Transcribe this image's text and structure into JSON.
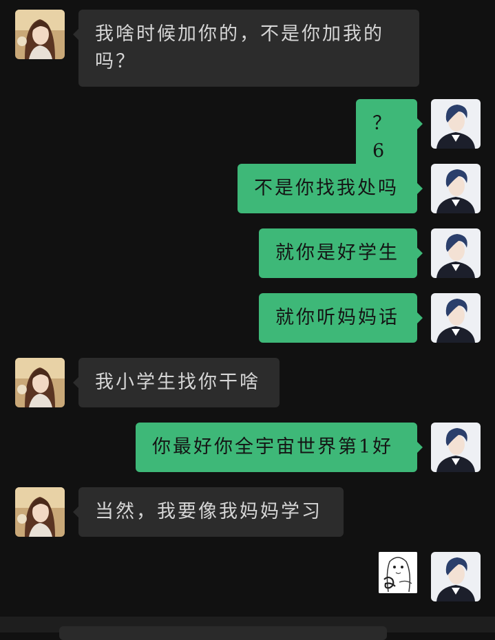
{
  "conversation": {
    "messages": [
      {
        "side": "in",
        "text": "我啥时候加你的，不是你加我的吗？"
      },
      {
        "side": "out",
        "text": "？6"
      },
      {
        "side": "out",
        "text": "不是你找我处吗"
      },
      {
        "side": "out",
        "text": "就你是好学生"
      },
      {
        "side": "out",
        "text": "就你听妈妈话"
      },
      {
        "side": "in",
        "text": "我小学生找你干啥"
      },
      {
        "side": "out",
        "text": "你最好你全宇宙世界第1好"
      },
      {
        "side": "in",
        "text": "当然，我要像我妈妈学习"
      },
      {
        "side": "out",
        "type": "sticker",
        "icon": "meme-sticker"
      }
    ]
  },
  "colors": {
    "background": "#111111",
    "incoming_bubble": "#2c2c2c",
    "outgoing_bubble": "#3eb878"
  }
}
